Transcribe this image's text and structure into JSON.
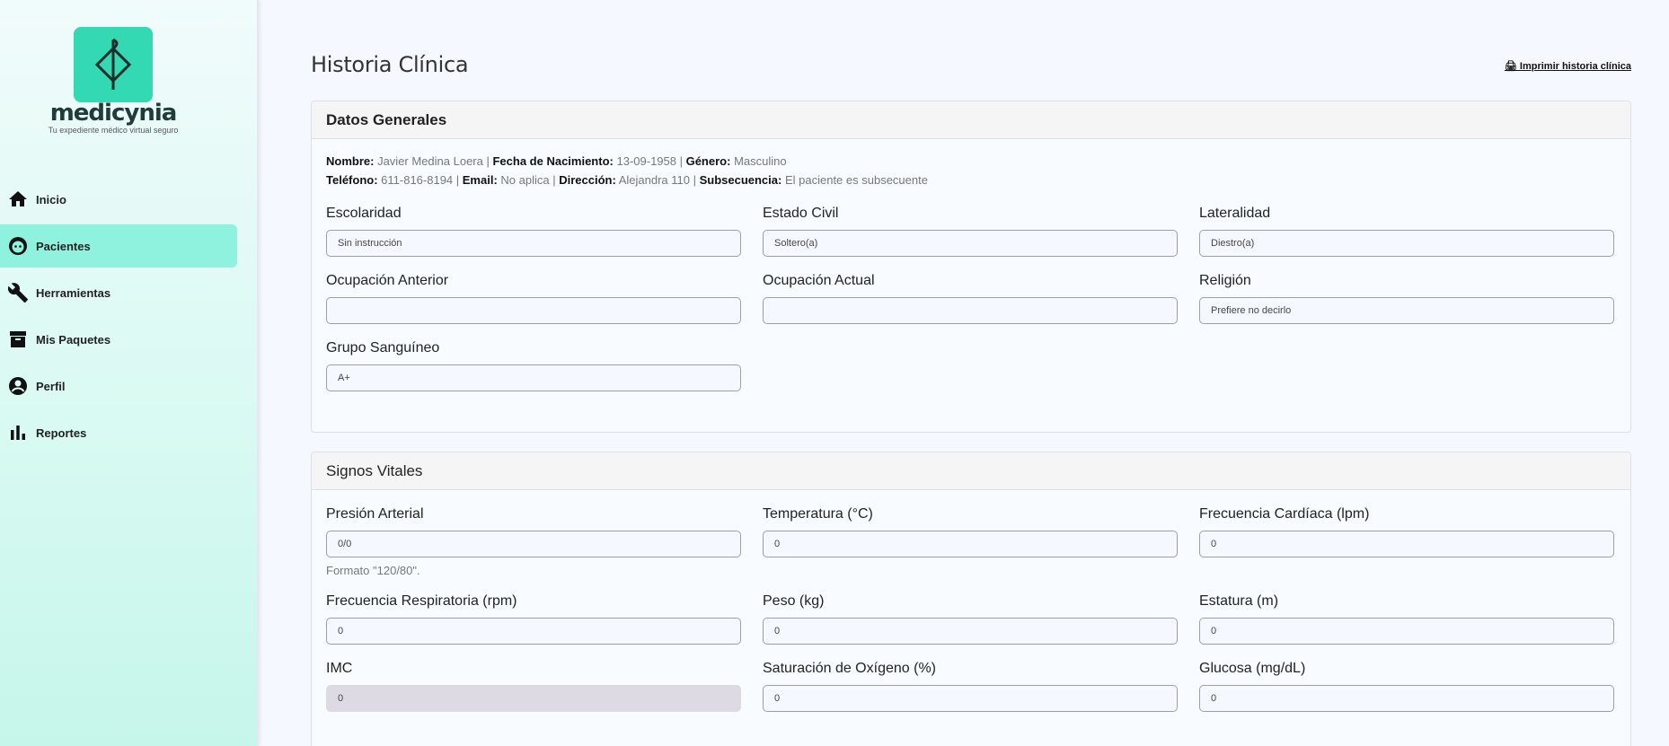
{
  "brand": {
    "name": "medicynia",
    "tagline": "Tu expediente médico virtual seguro"
  },
  "nav": [
    {
      "label": "Inicio",
      "icon": "home-icon",
      "active": false
    },
    {
      "label": "Pacientes",
      "icon": "patient-face-icon",
      "active": true
    },
    {
      "label": "Herramientas",
      "icon": "wrench-icon",
      "active": false
    },
    {
      "label": "Mis Paquetes",
      "icon": "archive-box-icon",
      "active": false
    },
    {
      "label": "Perfil",
      "icon": "user-circle-icon",
      "active": false
    },
    {
      "label": "Reportes",
      "icon": "bar-chart-icon",
      "active": false
    }
  ],
  "page": {
    "title": "Historia Clínica",
    "print_label": "🖨 Imprimir historia clínica"
  },
  "general": {
    "title": "Datos Generales",
    "nombre_label": "Nombre:",
    "nombre": "Javier Medina Loera",
    "nacimiento_label": "Fecha de Nacimiento:",
    "nacimiento": "13-09-1958",
    "genero_label": "Género:",
    "genero": "Masculino",
    "telefono_label": "Teléfono:",
    "telefono": "611-816-8194",
    "email_label": "Email:",
    "email": "No aplica",
    "direccion_label": "Dirección:",
    "direccion": "Alejandra 110",
    "subsecuencia_label": "Subsecuencia:",
    "subsecuencia": "El paciente es subsecuente",
    "sep": " | ",
    "fields": [
      {
        "label": "Escolaridad",
        "value": "Sin instrucción"
      },
      {
        "label": "Estado Civil",
        "value": "Soltero(a)"
      },
      {
        "label": "Lateralidad",
        "value": "Diestro(a)"
      },
      {
        "label": "Ocupación Anterior",
        "value": ""
      },
      {
        "label": "Ocupación Actual",
        "value": ""
      },
      {
        "label": "Religión",
        "value": "Prefiere no decirlo"
      },
      {
        "label": "Grupo Sanguíneo",
        "value": "A+"
      }
    ]
  },
  "vitals": {
    "title": "Signos Vitales",
    "fields": [
      {
        "label": "Presión Arterial",
        "value": "0/0",
        "help": "Formato \"120/80\"."
      },
      {
        "label": "Temperatura (°C)",
        "value": "0"
      },
      {
        "label": "Frecuencia Cardíaca (lpm)",
        "value": "0"
      },
      {
        "label": "Frecuencia Respiratoria (rpm)",
        "value": "0"
      },
      {
        "label": "Peso (kg)",
        "value": "0"
      },
      {
        "label": "Estatura (m)",
        "value": "0"
      },
      {
        "label": "IMC",
        "value": "0",
        "disabled": true
      },
      {
        "label": "Saturación de Oxígeno (%)",
        "value": "0"
      },
      {
        "label": "Glucosa (mg/dL)",
        "value": "0"
      }
    ]
  }
}
